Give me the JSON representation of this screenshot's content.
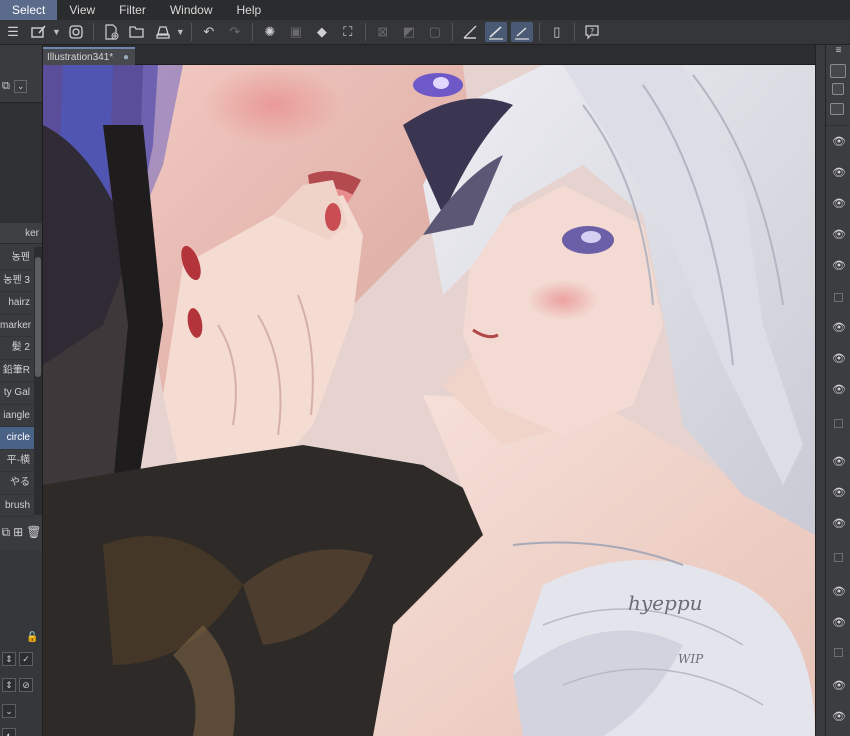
{
  "menu": {
    "items": [
      "Select",
      "View",
      "Filter",
      "Window",
      "Help"
    ],
    "active": "Select"
  },
  "toolbar": {
    "icons": [
      "hamburger-icon",
      "selection-edit-icon",
      "lasso-icon",
      "new-canvas-icon",
      "open-folder-icon",
      "save-icon",
      "undo-icon",
      "redo-icon",
      "loading-icon",
      "transform-icon",
      "fill-icon",
      "crop-icon",
      "clear-selection-icon",
      "invert-selection-icon",
      "stop-icon",
      "ruler-icon",
      "pen-stroke-icon",
      "pen-stroke-alt-icon",
      "tablet-icon",
      "help-icon"
    ]
  },
  "document": {
    "tab_label": "Illustration341*",
    "tab_dot": "●"
  },
  "left_panel": {
    "header_label": "ker",
    "brushes": [
      {
        "label": "농펜",
        "selected": false
      },
      {
        "label": "농펜 3",
        "selected": false
      },
      {
        "label": "hairz",
        "selected": false
      },
      {
        "label": "marker",
        "selected": false
      },
      {
        "label": "髪 2",
        "selected": false
      },
      {
        "label": "鉛筆R",
        "selected": false
      },
      {
        "label": "ty Gal",
        "selected": false
      },
      {
        "label": "iangle",
        "selected": false
      },
      {
        "label": "circle",
        "selected": true
      },
      {
        "label": "平-横",
        "selected": false
      },
      {
        "label": "やる",
        "selected": false
      },
      {
        "label": "brush",
        "selected": false
      }
    ]
  },
  "canvas": {
    "signature": "hyeppu",
    "wip_mark": "WIP"
  },
  "colors": {
    "accent": "#5a6b8c",
    "selected_row": "#4b6287",
    "panel_bg": "#3a3b3e"
  }
}
